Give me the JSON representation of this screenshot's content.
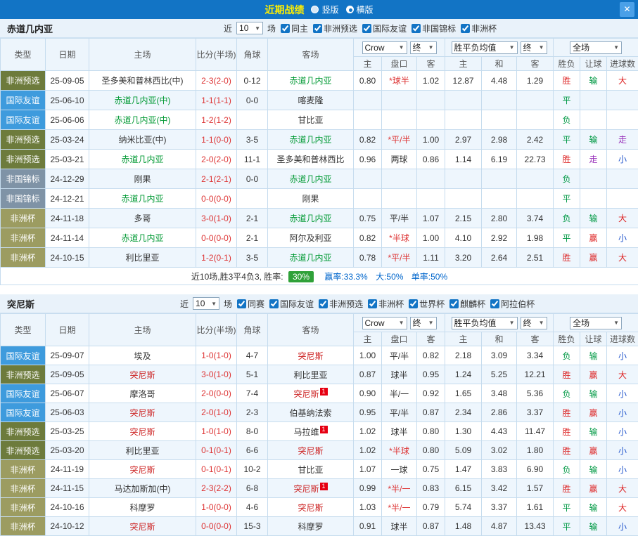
{
  "header": {
    "title": "近期战绩",
    "radios": [
      {
        "label": "竖版",
        "selected": false
      },
      {
        "label": "横版",
        "selected": true
      }
    ],
    "close_label": "✕"
  },
  "controls": {
    "near_label": "近",
    "near_value": "10",
    "matches_label": "场",
    "bookmaker_select": "Crow",
    "final_select": "终",
    "avg_select": "胜平负均值",
    "scope_select": "全场"
  },
  "columns": {
    "type": "类型",
    "date": "日期",
    "home": "主场",
    "score": "比分(半场)",
    "corner": "角球",
    "away": "客场",
    "ah_home": "主",
    "handicap": "盘口",
    "ah_away": "客",
    "eu_home": "主",
    "eu_draw": "和",
    "eu_away": "客",
    "result": "胜负",
    "let_result": "让球",
    "goal_result": "进球数"
  },
  "colors": {
    "type_colors": {
      "非洲预选": "#6d7b3c",
      "国际友谊": "#3e9bdd",
      "非国锦标": "#7f93a6",
      "非洲杯": "#9c9c61"
    },
    "result_colors": {
      "胜": "#dd2222",
      "平": "#009944",
      "负": "#009944",
      "赢": "#dd2222",
      "输": "#009944",
      "走": "#9933bb",
      "大": "#dd2222",
      "小": "#2255cc"
    },
    "score": "#dd3333",
    "handicap_star": "#dd3333",
    "plain_text": "#333333",
    "badge_bg": "#e60012",
    "summary_badge_bg": "#2fa139",
    "link_blue": "#0066cc"
  },
  "sections": [
    {
      "team": "赤道几内亚",
      "team_color": "#009933",
      "filters": [
        "同主",
        "非洲预选",
        "国际友谊",
        "非国锦标",
        "非洲杯"
      ],
      "rows": [
        {
          "type": "非洲预选",
          "date": "25-09-05",
          "home": "圣多美和普林西比(中)",
          "home_focus": false,
          "score": "2-3(2-0)",
          "corner": "0-12",
          "away": "赤道几内亚",
          "away_focus": true,
          "ah": [
            "0.80",
            "*球半",
            "1.02"
          ],
          "eu": [
            "12.87",
            "4.48",
            "1.29"
          ],
          "res": [
            "胜",
            "输",
            "大"
          ]
        },
        {
          "type": "国际友谊",
          "date": "25-06-10",
          "home": "赤道几内亚(中)",
          "home_focus": true,
          "score": "1-1(1-1)",
          "corner": "0-0",
          "away": "喀麦隆",
          "away_focus": false,
          "ah": [
            "",
            "",
            ""
          ],
          "eu": [
            "",
            "",
            ""
          ],
          "res": [
            "平",
            "",
            ""
          ]
        },
        {
          "type": "国际友谊",
          "date": "25-06-06",
          "home": "赤道几内亚(中)",
          "home_focus": true,
          "score": "1-2(1-2)",
          "corner": "",
          "away": "甘比亚",
          "away_focus": false,
          "ah": [
            "",
            "",
            ""
          ],
          "eu": [
            "",
            "",
            ""
          ],
          "res": [
            "负",
            "",
            ""
          ]
        },
        {
          "type": "非洲预选",
          "date": "25-03-24",
          "home": "纳米比亚(中)",
          "home_focus": false,
          "score": "1-1(0-0)",
          "corner": "3-5",
          "away": "赤道几内亚",
          "away_focus": true,
          "ah": [
            "0.82",
            "*平/半",
            "1.00"
          ],
          "eu": [
            "2.97",
            "2.98",
            "2.42"
          ],
          "res": [
            "平",
            "输",
            "走"
          ]
        },
        {
          "type": "非洲预选",
          "date": "25-03-21",
          "home": "赤道几内亚",
          "home_focus": true,
          "score": "2-0(2-0)",
          "corner": "11-1",
          "away": "圣多美和普林西比",
          "away_focus": false,
          "ah": [
            "0.96",
            "两球",
            "0.86"
          ],
          "eu": [
            "1.14",
            "6.19",
            "22.73"
          ],
          "res": [
            "胜",
            "走",
            "小"
          ]
        },
        {
          "type": "非国锦标",
          "date": "24-12-29",
          "home": "刚果",
          "home_focus": false,
          "score": "2-1(2-1)",
          "corner": "0-0",
          "away": "赤道几内亚",
          "away_focus": true,
          "ah": [
            "",
            "",
            ""
          ],
          "eu": [
            "",
            "",
            ""
          ],
          "res": [
            "负",
            "",
            ""
          ]
        },
        {
          "type": "非国锦标",
          "date": "24-12-21",
          "home": "赤道几内亚",
          "home_focus": true,
          "score": "0-0(0-0)",
          "corner": "",
          "away": "刚果",
          "away_focus": false,
          "ah": [
            "",
            "",
            ""
          ],
          "eu": [
            "",
            "",
            ""
          ],
          "res": [
            "平",
            "",
            ""
          ]
        },
        {
          "type": "非洲杯",
          "date": "24-11-18",
          "home": "多哥",
          "home_focus": false,
          "score": "3-0(1-0)",
          "corner": "2-1",
          "away": "赤道几内亚",
          "away_focus": true,
          "ah": [
            "0.75",
            "平/半",
            "1.07"
          ],
          "eu": [
            "2.15",
            "2.80",
            "3.74"
          ],
          "res": [
            "负",
            "输",
            "大"
          ]
        },
        {
          "type": "非洲杯",
          "date": "24-11-14",
          "home": "赤道几内亚",
          "home_focus": true,
          "score": "0-0(0-0)",
          "corner": "2-1",
          "away": "阿尔及利亚",
          "away_focus": false,
          "ah": [
            "0.82",
            "*半球",
            "1.00"
          ],
          "eu": [
            "4.10",
            "2.92",
            "1.98"
          ],
          "res": [
            "平",
            "赢",
            "小"
          ]
        },
        {
          "type": "非洲杯",
          "date": "24-10-15",
          "home": "利比里亚",
          "home_focus": false,
          "score": "1-2(0-1)",
          "corner": "3-5",
          "away": "赤道几内亚",
          "away_focus": true,
          "ah": [
            "0.78",
            "*平/半",
            "1.11"
          ],
          "eu": [
            "3.20",
            "2.64",
            "2.51"
          ],
          "res": [
            "胜",
            "赢",
            "大"
          ]
        }
      ],
      "summary": {
        "prefix": "近10场,胜3平4负3, 胜率:",
        "rate": "30%",
        "win_rate": "赢率:33.3%",
        "big_rate": "大:50%",
        "single_rate": "单率:50%"
      }
    },
    {
      "team": "突尼斯",
      "team_color": "#cc2222",
      "filters": [
        "同赛",
        "国际友谊",
        "非洲预选",
        "非洲杯",
        "世界杯",
        "麒麟杯",
        "阿拉伯杯"
      ],
      "rows": [
        {
          "type": "国际友谊",
          "date": "25-09-07",
          "home": "埃及",
          "home_focus": false,
          "score": "1-0(1-0)",
          "corner": "4-7",
          "away": "突尼斯",
          "away_focus": true,
          "ah": [
            "1.00",
            "平/半",
            "0.82"
          ],
          "eu": [
            "2.18",
            "3.09",
            "3.34"
          ],
          "res": [
            "负",
            "输",
            "小"
          ]
        },
        {
          "type": "非洲预选",
          "date": "25-09-05",
          "home": "突尼斯",
          "home_focus": true,
          "score": "3-0(1-0)",
          "corner": "5-1",
          "away": "利比里亚",
          "away_focus": false,
          "ah": [
            "0.87",
            "球半",
            "0.95"
          ],
          "eu": [
            "1.24",
            "5.25",
            "12.21"
          ],
          "res": [
            "胜",
            "赢",
            "大"
          ]
        },
        {
          "type": "国际友谊",
          "date": "25-06-07",
          "home": "摩洛哥",
          "home_focus": false,
          "score": "2-0(0-0)",
          "corner": "7-4",
          "away": "突尼斯",
          "away_focus": true,
          "away_badge": "1",
          "ah": [
            "0.90",
            "半/一",
            "0.92"
          ],
          "eu": [
            "1.65",
            "3.48",
            "5.36"
          ],
          "res": [
            "负",
            "输",
            "小"
          ]
        },
        {
          "type": "国际友谊",
          "date": "25-06-03",
          "home": "突尼斯",
          "home_focus": true,
          "score": "2-0(1-0)",
          "corner": "2-3",
          "away": "伯基纳法索",
          "away_focus": false,
          "ah": [
            "0.95",
            "平/半",
            "0.87"
          ],
          "eu": [
            "2.34",
            "2.86",
            "3.37"
          ],
          "res": [
            "胜",
            "赢",
            "小"
          ]
        },
        {
          "type": "非洲预选",
          "date": "25-03-25",
          "home": "突尼斯",
          "home_focus": true,
          "score": "1-0(1-0)",
          "corner": "8-0",
          "away": "马拉维",
          "away_focus": false,
          "away_badge": "1",
          "ah": [
            "1.02",
            "球半",
            "0.80"
          ],
          "eu": [
            "1.30",
            "4.43",
            "11.47"
          ],
          "res": [
            "胜",
            "输",
            "小"
          ]
        },
        {
          "type": "非洲预选",
          "date": "25-03-20",
          "home": "利比里亚",
          "home_focus": false,
          "score": "0-1(0-1)",
          "corner": "6-6",
          "away": "突尼斯",
          "away_focus": true,
          "ah": [
            "1.02",
            "*半球",
            "0.80"
          ],
          "eu": [
            "5.09",
            "3.02",
            "1.80"
          ],
          "res": [
            "胜",
            "赢",
            "小"
          ]
        },
        {
          "type": "非洲杯",
          "date": "24-11-19",
          "home": "突尼斯",
          "home_focus": true,
          "score": "0-1(0-1)",
          "corner": "10-2",
          "away": "甘比亚",
          "away_focus": false,
          "ah": [
            "1.07",
            "一球",
            "0.75"
          ],
          "eu": [
            "1.47",
            "3.83",
            "6.90"
          ],
          "res": [
            "负",
            "输",
            "小"
          ]
        },
        {
          "type": "非洲杯",
          "date": "24-11-15",
          "home": "马达加斯加(中)",
          "home_focus": false,
          "score": "2-3(2-2)",
          "corner": "6-8",
          "away": "突尼斯",
          "away_focus": true,
          "away_badge": "1",
          "ah": [
            "0.99",
            "*半/一",
            "0.83"
          ],
          "eu": [
            "6.15",
            "3.42",
            "1.57"
          ],
          "res": [
            "胜",
            "赢",
            "大"
          ]
        },
        {
          "type": "非洲杯",
          "date": "24-10-16",
          "home": "科摩罗",
          "home_focus": false,
          "score": "1-0(0-0)",
          "corner": "4-6",
          "away": "突尼斯",
          "away_focus": true,
          "ah": [
            "1.03",
            "*半/一",
            "0.79"
          ],
          "eu": [
            "5.74",
            "3.37",
            "1.61"
          ],
          "res": [
            "平",
            "输",
            "大"
          ]
        },
        {
          "type": "非洲杯",
          "date": "24-10-12",
          "home": "突尼斯",
          "home_focus": true,
          "score": "0-0(0-0)",
          "corner": "15-3",
          "away": "科摩罗",
          "away_focus": false,
          "ah": [
            "0.91",
            "球半",
            "0.87"
          ],
          "eu": [
            "1.48",
            "4.87",
            "13.43"
          ],
          "res": [
            "平",
            "输",
            "小"
          ]
        }
      ]
    }
  ]
}
